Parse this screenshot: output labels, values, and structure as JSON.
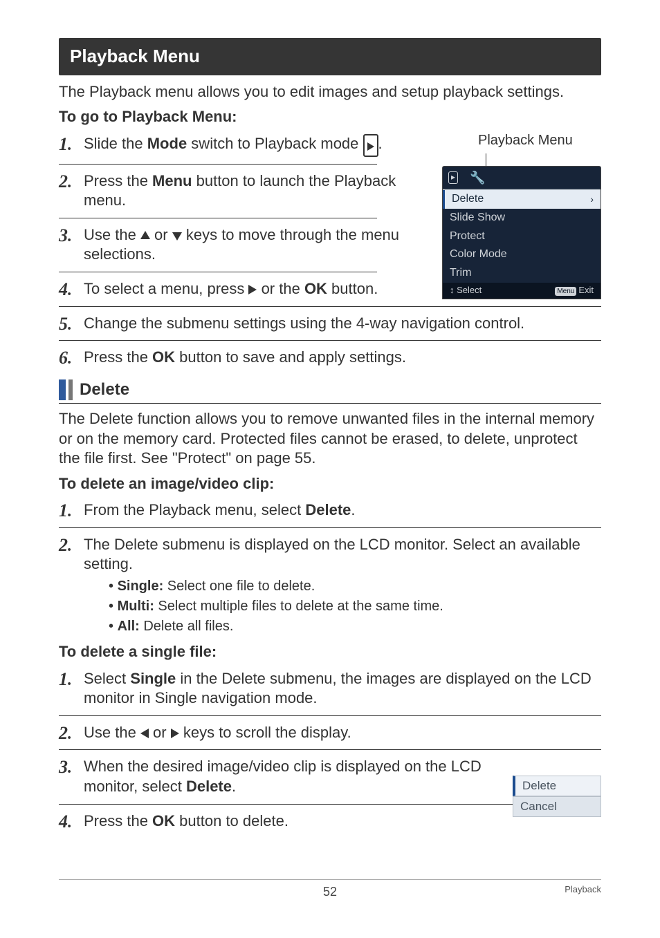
{
  "title_bar": "Playback Menu",
  "intro": "The Playback menu allows you to edit images and setup playback settings.",
  "goto_heading": "To go to Playback Menu:",
  "steps_top": {
    "s1": {
      "pre": "Slide the ",
      "kw": "Mode",
      "post": " switch to Playback mode "
    },
    "s2": {
      "pre": "Press the ",
      "kw": "Menu",
      "post": " button to launch the Playback menu."
    },
    "s3": {
      "pre": "Use the ",
      "mid": " or ",
      "post": " keys to move through the menu selections."
    },
    "s4": {
      "pre": "To select a menu, press ",
      "mid": " or the ",
      "kw": "OK",
      "post": " button."
    },
    "s5": "Change the submenu settings using the 4-way navigation control.",
    "s6": {
      "pre": "Press the ",
      "kw": "OK",
      "post": " button to save and apply settings."
    }
  },
  "side": {
    "label": "Playback Menu",
    "menu": {
      "items": [
        "Delete",
        "Slide Show",
        "Protect",
        "Color Mode",
        "Trim"
      ],
      "foot_left_icon": "↕",
      "foot_left": " Select",
      "foot_right_pill": "Menu",
      "foot_right": "Exit"
    }
  },
  "delete_head": "Delete",
  "delete_para": "The Delete function allows you to remove unwanted files in the internal memory or on the memory card. Protected files cannot be erased, to delete, unprotect the file first. See \"Protect\" on page 55.",
  "del_img_head": "To delete an image/video clip:",
  "steps_mid": {
    "s1": {
      "pre": "From the Playback menu, select ",
      "kw": "Delete",
      "post": "."
    },
    "s2": "The Delete submenu is displayed on the LCD monitor. Select an available setting."
  },
  "bullets": {
    "b1": {
      "kw": "Single:",
      "post": " Select one file to delete."
    },
    "b2": {
      "kw": "Multi:",
      "post": " Select multiple files to delete at the same time."
    },
    "b3": {
      "kw": "All:",
      "post": " Delete all files."
    }
  },
  "del_single_head": "To delete a single file:",
  "steps_bot": {
    "s1": {
      "pre": "Select ",
      "kw": "Single",
      "post": " in the Delete submenu, the images are displayed on the LCD monitor in Single navigation mode."
    },
    "s2": {
      "pre": "Use the ",
      "mid": " or ",
      "post": " keys to scroll the display."
    },
    "s3": {
      "pre": "When the desired image/video clip is displayed on the LCD monitor, select ",
      "kw": "Delete",
      "post": "."
    },
    "s4": {
      "pre": "Press the ",
      "kw": "OK",
      "post": " button to delete."
    }
  },
  "mini": {
    "a": "Delete",
    "b": "Cancel"
  },
  "footer": {
    "page": "52",
    "section": "Playback"
  }
}
